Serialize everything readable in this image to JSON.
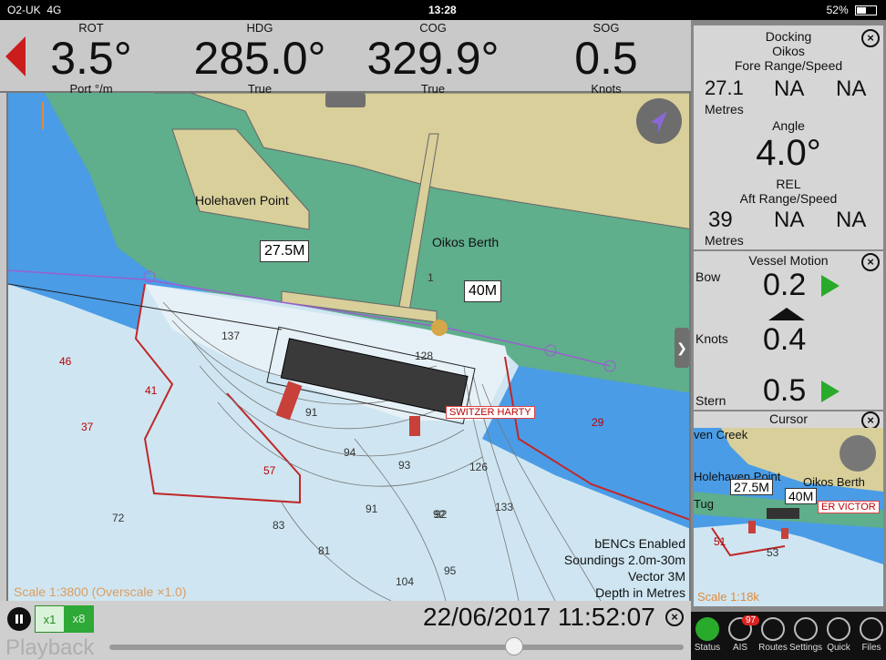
{
  "status_bar": {
    "carrier": "O2-UK",
    "network": "4G",
    "time": "13:28",
    "battery": "52%",
    "battery_level": 0.52
  },
  "instruments": [
    {
      "label": "ROT",
      "value": "3.5°",
      "unit": "Port °/m"
    },
    {
      "label": "HDG",
      "value": "285.0°",
      "unit": "True"
    },
    {
      "label": "COG",
      "value": "329.9°",
      "unit": "True"
    },
    {
      "label": "SOG",
      "value": "0.5",
      "unit": "Knots"
    }
  ],
  "map": {
    "places": [
      "Holehaven Point",
      "Oikos Berth"
    ],
    "range_labels": [
      "27.5M",
      "40M"
    ],
    "vessel_label": "SWITZER HARTY",
    "soundings": [
      "46",
      "41",
      "37",
      "57",
      "72",
      "29",
      "91",
      "94",
      "93",
      "91",
      "92",
      "95",
      "81",
      "83",
      "104",
      "133",
      "126",
      "128",
      "137",
      "1",
      "92"
    ],
    "info_lines": [
      "bENCs Enabled",
      "Soundings 2.0m-30m",
      "Vector 3M",
      "Depth in Metres"
    ],
    "scale_text": "Scale 1:3800 (Overscale ×1.0)",
    "colors": {
      "land": "#d8cf9a",
      "shallow": "#4a9ce6",
      "deep": "#cfe6f2",
      "intertidal": "#5fae8c",
      "contour": "#c0282a",
      "vessel": "#3a3a3a"
    }
  },
  "playback": {
    "label": "Playback",
    "speeds": [
      "x1",
      "x8"
    ],
    "datetime": "22/06/2017 11:52:07",
    "position": 0.7
  },
  "docking": {
    "title": "Docking",
    "vessel": "Oikos",
    "fore_header": "Fore Range/Speed",
    "fore_range": "27.1",
    "fore_speed1": "NA",
    "fore_speed2": "NA",
    "fore_unit": "Metres",
    "angle_header": "Angle",
    "angle_value": "4.0°",
    "angle_ref": "REL",
    "aft_header": "Aft Range/Speed",
    "aft_range": "39",
    "aft_speed1": "NA",
    "aft_speed2": "NA",
    "aft_unit": "Metres"
  },
  "motion": {
    "title": "Vessel Motion",
    "bow_label": "Bow",
    "bow_value": "0.2",
    "mid_label": "Knots",
    "mid_value": "0.4",
    "stern_label": "Stern",
    "stern_value": "0.5"
  },
  "cursor_panel": {
    "title": "Cursor",
    "places": [
      "ven Creek",
      "Holehaven Point",
      "Oikos Berth",
      "Tug"
    ],
    "range_labels": [
      "27.5M",
      "40M"
    ],
    "vessel_label": "ER VICTOR",
    "soundings": [
      "51",
      "53"
    ],
    "scale_text": "Scale 1:18k"
  },
  "toolbar": {
    "items": [
      {
        "label": "Status",
        "icon": "status-icon"
      },
      {
        "label": "AIS",
        "icon": "ais-icon",
        "badge": "97"
      },
      {
        "label": "Routes",
        "icon": "routes-icon"
      },
      {
        "label": "Settings",
        "icon": "settings-icon"
      },
      {
        "label": "Quick",
        "icon": "quick-icon"
      },
      {
        "label": "Files",
        "icon": "files-icon"
      }
    ]
  }
}
